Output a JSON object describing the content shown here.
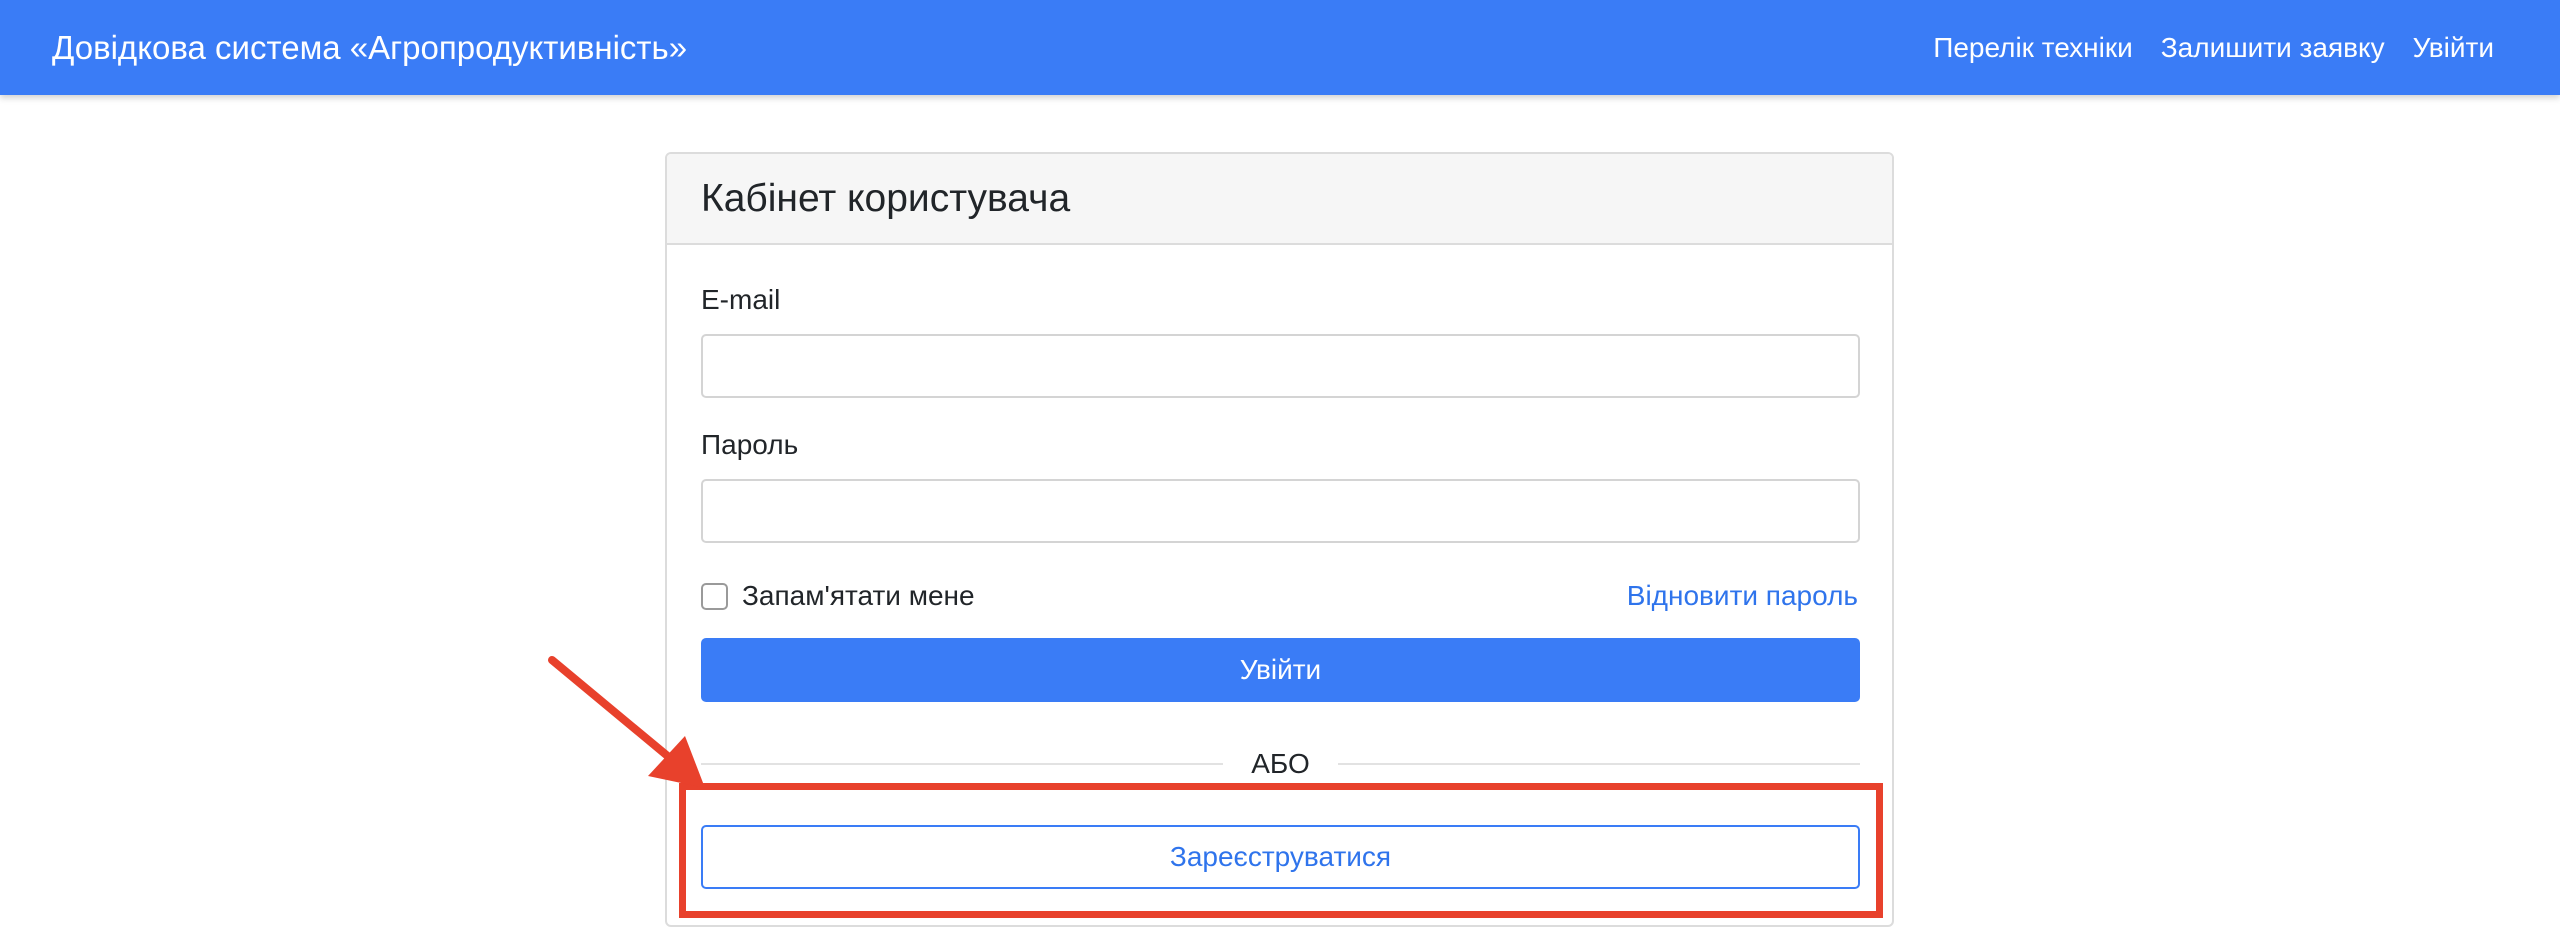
{
  "navbar": {
    "brand": "Довідкова система «Агропродуктивність»",
    "links": [
      {
        "label": "Перелік техніки"
      },
      {
        "label": "Залишити заявку"
      },
      {
        "label": "Увійти"
      }
    ]
  },
  "card": {
    "title": "Кабінет користувача",
    "email_label": "E-mail",
    "email_value": "",
    "password_label": "Пароль",
    "password_value": "",
    "remember_label": "Запам'ятати мене",
    "remember_checked": false,
    "forgot_password": "Відновити пароль",
    "login_button": "Увійти",
    "divider_text": "АБО",
    "register_button": "Зареєструватися"
  },
  "colors": {
    "primary": "#3a7cf6",
    "link": "#2f74ec",
    "annotation": "#e8412c"
  },
  "annotation": {
    "arrow_icon": "arrow-icon",
    "highlight_target": "register-button"
  }
}
